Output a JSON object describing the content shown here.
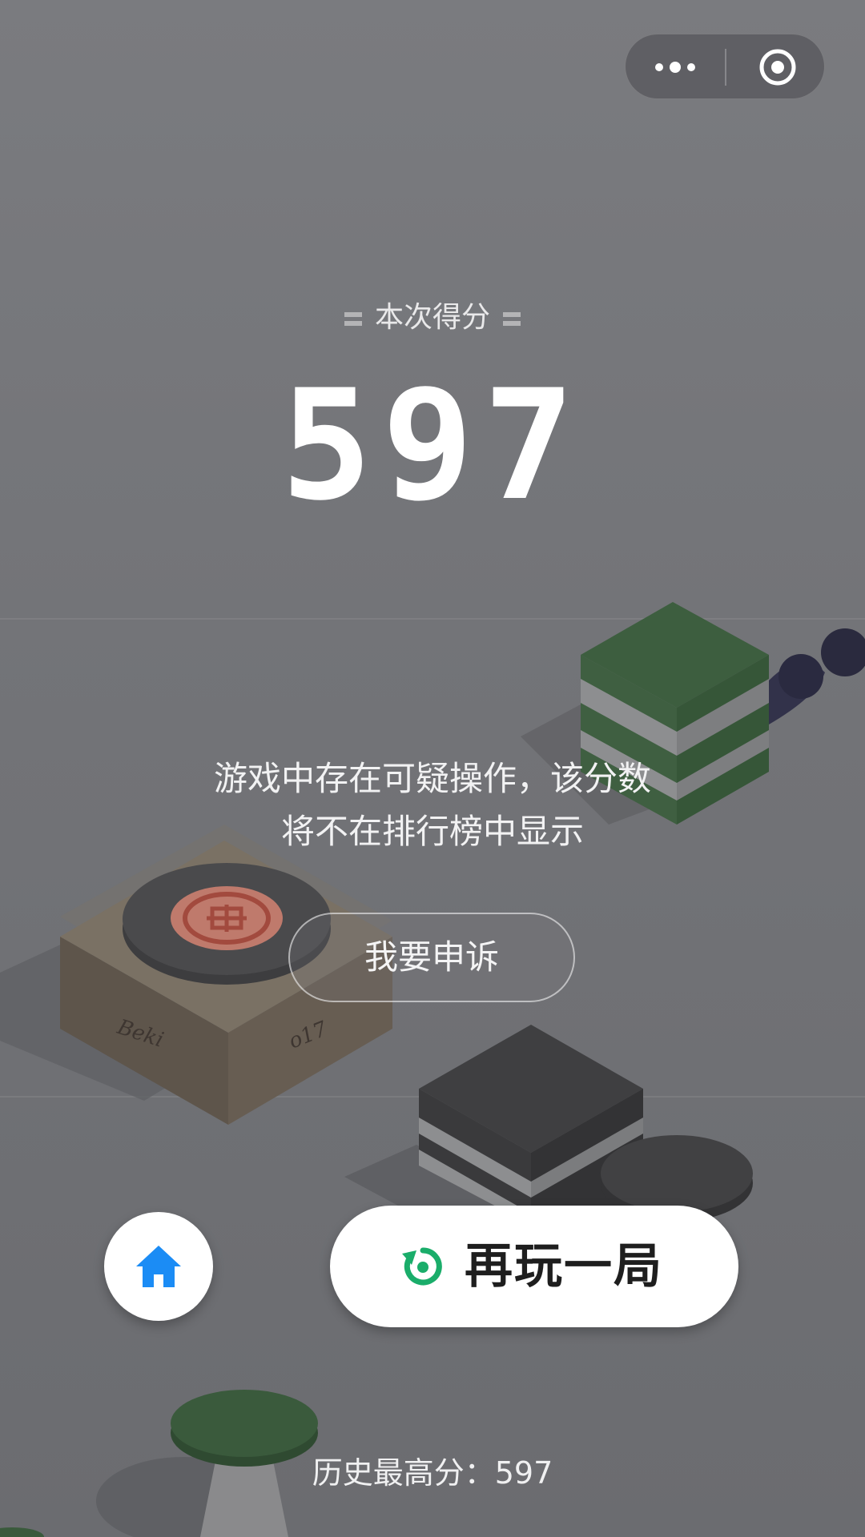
{
  "topbar": {
    "more_icon": "more-dots-icon",
    "close_icon": "target-circle-icon"
  },
  "score": {
    "label": "本次得分",
    "value": "597"
  },
  "warning": {
    "line1": "游戏中存在可疑操作，该分数",
    "line2": "将不在排行榜中显示"
  },
  "appeal_label": "我要申诉",
  "home_icon": "home-icon",
  "replay": {
    "icon": "replay-icon",
    "label": "再玩一局"
  },
  "best_score": {
    "label": "历史最高分：",
    "value": "597"
  },
  "colors": {
    "background": "#737478",
    "home_icon": "#1b8cf5",
    "replay_icon": "#1aad6a",
    "green_block": "#3a5a3c"
  }
}
